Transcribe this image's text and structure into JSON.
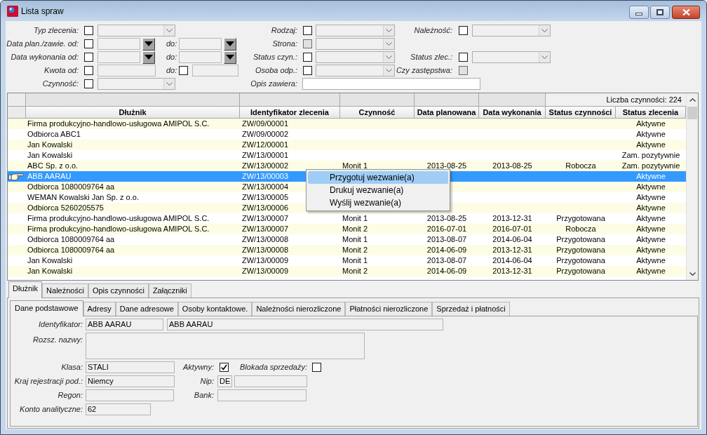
{
  "window": {
    "title": "Lista spraw"
  },
  "filters": [
    [
      {
        "kind": "combo",
        "label": "Typ zlecenia:",
        "checked": false,
        "disabled": false
      },
      {
        "kind": "combo",
        "label": "Rodzaj:",
        "checked": false,
        "disabled": false
      },
      {
        "kind": "combo",
        "label": "Należność:",
        "checked": false,
        "disabled": false
      }
    ],
    [
      {
        "kind": "date_range",
        "label": "Data plan./zawie. od:",
        "to_label": "do:",
        "checked": false,
        "disabled": false
      },
      {
        "kind": "combo",
        "label": "Strona:",
        "checked": false,
        "disabled": true
      }
    ],
    [
      {
        "kind": "date_range",
        "label": "Data wykonania od:",
        "to_label": "do:",
        "checked": false,
        "disabled": false
      },
      {
        "kind": "combo",
        "label": "Status czyn.:",
        "checked": false,
        "disabled": false
      },
      {
        "kind": "combo",
        "label": "Status zlec.:",
        "checked": false,
        "disabled": false
      }
    ],
    [
      {
        "kind": "amount_range",
        "label": "Kwota od:",
        "to_label": "do:",
        "checked": false,
        "to_checked": false,
        "disabled": false
      },
      {
        "kind": "combo",
        "label": "Osoba odp.:",
        "checked": false,
        "disabled": false
      },
      {
        "kind": "checkbox",
        "label": "Czy zastępstwa:",
        "checked": false,
        "disabled": true
      }
    ],
    [
      {
        "kind": "combo",
        "label": "Czynność:",
        "checked": false,
        "disabled": false
      },
      {
        "kind": "text",
        "label": "Opis zawiera:"
      }
    ]
  ],
  "table": {
    "summary": "Liczba czynności: 224",
    "columns": [
      "Dłużnik",
      "Identyfikator zlecenia",
      "Czynność",
      "Data planowana",
      "Data wykonania",
      "Status czynności",
      "Status zlecenia"
    ],
    "rows": [
      {
        "debtor": "Firma produkcyjno-handlowo-usługowa AMIPOL S.C.",
        "order_id": "ZW/09/00001",
        "order_status": "Aktywne",
        "selected": false
      },
      {
        "debtor": "Odbiorca ABC1",
        "order_id": "ZW/09/00002",
        "order_status": "Aktywne",
        "selected": false
      },
      {
        "debtor": "Jan Kowalski",
        "order_id": "ZW/12/00001",
        "order_status": "Aktywne",
        "selected": false
      },
      {
        "debtor": "Jan Kowalski",
        "order_id": "ZW/13/00001",
        "order_status": "Zam. pozytywnie",
        "selected": false
      },
      {
        "debtor": "ABC Sp. z o.o.",
        "order_id": "ZW/13/00002",
        "activity": "Monit 1",
        "planned_date": "2013-08-25",
        "done_date": "2013-08-25",
        "activity_status": "Robocza",
        "order_status": "Zam. pozytywnie",
        "selected": false
      },
      {
        "debtor": "ABB AARAU",
        "order_id": "ZW/13/00003",
        "order_status": "Aktywne",
        "selected": true
      },
      {
        "debtor": "Odbiorca 1080009764 aa",
        "order_id": "ZW/13/00004",
        "order_status": "Aktywne",
        "selected": false
      },
      {
        "debtor": "WEMAN Kowalski Jan Sp. z o.o.",
        "order_id": "ZW/13/00005",
        "order_status": "Aktywne",
        "selected": false
      },
      {
        "debtor": "Odbiorca 5260205575",
        "order_id": "ZW/13/00006",
        "order_status": "Aktywne",
        "selected": false
      },
      {
        "debtor": "Firma produkcyjno-handlowo-usługowa AMIPOL S.C.",
        "order_id": "ZW/13/00007",
        "activity": "Monit 1",
        "planned_date": "2013-08-25",
        "done_date": "2013-12-31",
        "activity_status": "Przygotowana",
        "order_status": "Aktywne",
        "selected": false
      },
      {
        "debtor": "Firma produkcyjno-handlowo-usługowa AMIPOL S.C.",
        "order_id": "ZW/13/00007",
        "activity": "Monit 2",
        "planned_date": "2016-07-01",
        "done_date": "2016-07-01",
        "activity_status": "Robocza",
        "order_status": "Aktywne",
        "selected": false
      },
      {
        "debtor": "Odbiorca 1080009764 aa",
        "order_id": "ZW/13/00008",
        "activity": "Monit 1",
        "planned_date": "2013-08-07",
        "done_date": "2014-06-04",
        "activity_status": "Przygotowana",
        "order_status": "Aktywne",
        "selected": false
      },
      {
        "debtor": "Odbiorca 1080009764 aa",
        "order_id": "ZW/13/00008",
        "activity": "Monit 2",
        "planned_date": "2014-06-09",
        "done_date": "2013-12-31",
        "activity_status": "Przygotowana",
        "order_status": "Aktywne",
        "selected": false
      },
      {
        "debtor": "Jan Kowalski",
        "order_id": "ZW/13/00009",
        "activity": "Monit 1",
        "planned_date": "2013-08-07",
        "done_date": "2014-06-04",
        "activity_status": "Przygotowana",
        "order_status": "Aktywne",
        "selected": false
      },
      {
        "debtor": "Jan Kowalski",
        "order_id": "ZW/13/00009",
        "activity": "Monit 2",
        "planned_date": "2014-06-09",
        "done_date": "2013-12-31",
        "activity_status": "Przygotowana",
        "order_status": "Aktywne",
        "selected": false
      }
    ]
  },
  "context_menu": {
    "items": [
      {
        "label": "Przygotuj wezwanie(a)",
        "highlighted": true
      },
      {
        "label": "Drukuj wezwanie(a)",
        "highlighted": false
      },
      {
        "label": "Wyślij wezwanie(a)",
        "highlighted": false
      }
    ]
  },
  "detail": {
    "tabs": [
      {
        "label": "Dłużnik",
        "selected": true
      },
      {
        "label": "Należności",
        "selected": false
      },
      {
        "label": "Opis czynności",
        "selected": false
      },
      {
        "label": "Załączniki",
        "selected": false
      }
    ],
    "subtabs": [
      {
        "label": "Dane podstawowe",
        "selected": true
      },
      {
        "label": "Adresy",
        "selected": false
      },
      {
        "label": "Dane adresowe",
        "selected": false
      },
      {
        "label": "Osoby kontaktowe.",
        "selected": false
      },
      {
        "label": "Należności nierozliczone",
        "selected": false
      },
      {
        "label": "Płatności nierozliczone",
        "selected": false
      },
      {
        "label": "Sprzedaż i płatności",
        "selected": false
      }
    ],
    "form": {
      "identifier": {
        "label": "Identyfikator:",
        "code": "ABB AARAU",
        "name": "ABB AARAU"
      },
      "extended_name": {
        "label": "Rozsz. nazwy:"
      },
      "class": {
        "label": "Klasa:",
        "value": "STALI"
      },
      "active": {
        "label": "Aktywny:",
        "checked": true
      },
      "sales_block": {
        "label": "Blokada sprzedaży:",
        "checked": false
      },
      "country": {
        "label": "Kraj rejestracji pod.:",
        "value": "Niemcy"
      },
      "nip": {
        "label": "Nip:",
        "prefix": "DE"
      },
      "regon": {
        "label": "Regon:"
      },
      "bank": {
        "label": "Bank:"
      },
      "account": {
        "label": "Konto analityczne:",
        "value": "62"
      }
    }
  }
}
